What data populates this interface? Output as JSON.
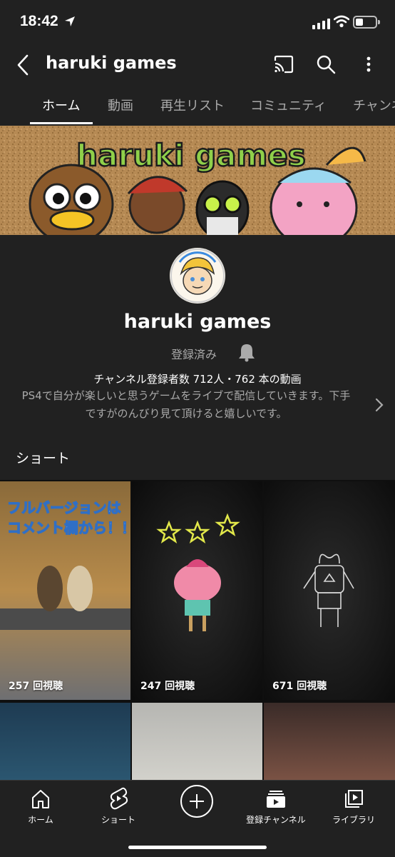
{
  "status_bar": {
    "time": "18:42"
  },
  "app_bar": {
    "title": "haruki games"
  },
  "tabs": [
    {
      "label": "ホーム",
      "active": true
    },
    {
      "label": "動画",
      "active": false
    },
    {
      "label": "再生リスト",
      "active": false
    },
    {
      "label": "コミュニティ",
      "active": false
    },
    {
      "label": "チャンネル",
      "active": false
    }
  ],
  "banner": {
    "logo_text": "haruki games"
  },
  "channel": {
    "name": "haruki games",
    "subscribed_label": "登録済み",
    "stats": "チャンネル登録者数 712人・762 本の動画",
    "description_line1": "PS4で自分が楽しいと思うゲームをライブで配信していきます。下手",
    "description_line2": "ですがのんびり見て頂けると嬉しいです。"
  },
  "shorts": {
    "heading": "ショート",
    "items": [
      {
        "views": "257 回視聴",
        "overlay_text_line1": "フルバージョンは",
        "overlay_text_line2": "コメント欄から！！"
      },
      {
        "views": "247 回視聴"
      },
      {
        "views": "671 回視聴"
      }
    ]
  },
  "bottom_nav": [
    {
      "label": "ホーム",
      "icon": "home-icon"
    },
    {
      "label": "ショート",
      "icon": "shorts-icon"
    },
    {
      "label": "",
      "icon": "create-icon"
    },
    {
      "label": "登録チャンネル",
      "icon": "subscriptions-icon"
    },
    {
      "label": "ライブラリ",
      "icon": "library-icon"
    }
  ],
  "colors": {
    "surface": "#212121",
    "background": "#0f0f0f",
    "secondary_text": "#aaaaaa",
    "text": "#ffffff"
  }
}
